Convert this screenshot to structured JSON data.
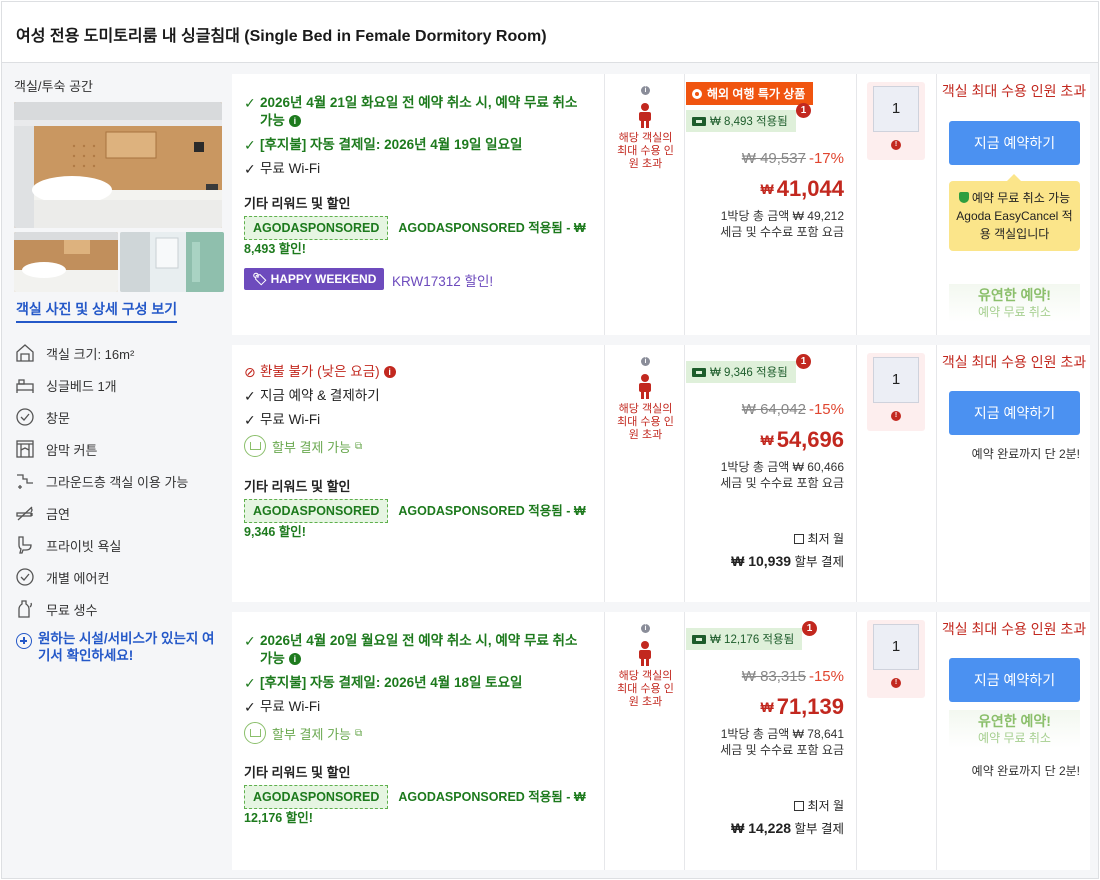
{
  "room": {
    "title": "여성 전용 도미토리룸 내 싱글침대 (Single Bed in Female Dormitory Room)",
    "space_label": "객실/투숙 공간",
    "photos_link": "객실 사진 및 상세 구성 보기",
    "features": [
      {
        "icon": "room-size-icon",
        "label": "객실 크기: 16m²"
      },
      {
        "icon": "single-bed-icon",
        "label": "싱글베드 1개"
      },
      {
        "icon": "window-icon",
        "label": "창문"
      },
      {
        "icon": "blackout-curtain-icon",
        "label": "암막 커튼"
      },
      {
        "icon": "ground-floor-icon",
        "label": "그라운드층 객실 이용 가능"
      },
      {
        "icon": "no-smoking-icon",
        "label": "금연"
      },
      {
        "icon": "private-bathroom-icon",
        "label": "프라이빗 욕실"
      },
      {
        "icon": "air-conditioner-icon",
        "label": "개별 에어컨"
      },
      {
        "icon": "water-bottle-icon",
        "label": "무료 생수"
      }
    ],
    "help_link": "원하는 시설/서비스가 있는지 여기서 확인하세요!"
  },
  "common": {
    "rewards_heading": "기타 리워드 및 할인",
    "agoda_tag": "AGODASPONSORED",
    "occupancy_text": "해당 객실의 최대 수용 인원 초과",
    "qty_value": "1",
    "max_occupancy": "객실 최대 수용 인원 초과",
    "book_button": "지금 예약하기",
    "flex_title": "유연한 예약!",
    "flex_sub": "예약 무료 취소",
    "finish_note": "예약 완료까지 단 2분!",
    "installment_available": "할부 결제 가능",
    "installment_min_label": "최저 월",
    "installment_suffix": "할부 결제",
    "per_night_prefix": "1박당 총 금액",
    "tax_note": "세금 및 수수료 포함 요금",
    "currency": "₩",
    "free_wifi": "무료 Wi-Fi"
  },
  "offers": [
    {
      "lines": [
        {
          "kind": "green",
          "text": "2026년 4월 21일 화요일 전 예약 취소 시, 예약 무료 취소 가능",
          "info": true
        },
        {
          "kind": "green",
          "text": "[후지불] 자동 결제일: 2026년 4월 19일 일요일"
        },
        {
          "kind": "plain",
          "text": "무료 Wi-Fi"
        }
      ],
      "promo_text": "AGODASPONSORED 적용됨 - ₩ 8,493 할인!",
      "happy_tag": "HAPPY WEEKEND",
      "happy_text": "KRW17312 할인!",
      "deal_badge": "해외 여행 특가 상품",
      "coupon": "₩ 8,493 적용됨",
      "coupon_count": "1",
      "original_price": "₩ 49,537",
      "discount_pct": "-17%",
      "price": "41,044",
      "per_night": "₩ 49,212",
      "tooltip_title": "예약 무료 취소 가능",
      "tooltip_body": "Agoda EasyCancel 적용 객실입니다"
    },
    {
      "lines": [
        {
          "kind": "red",
          "text": "환불 불가 (낮은 요금)",
          "info": true
        },
        {
          "kind": "plain",
          "text": "지금 예약 & 결제하기"
        },
        {
          "kind": "plain",
          "text": "무료 Wi-Fi"
        }
      ],
      "promo_text": "AGODASPONSORED 적용됨 - ₩ 9,346 할인!",
      "coupon": "₩ 9,346 적용됨",
      "coupon_count": "1",
      "original_price": "₩ 64,042",
      "discount_pct": "-15%",
      "price": "54,696",
      "per_night": "₩ 60,466",
      "installment_amount": "₩ 10,939"
    },
    {
      "lines": [
        {
          "kind": "green",
          "text": "2026년 4월 20일 월요일 전 예약 취소 시, 예약 무료 취소 가능",
          "info": true
        },
        {
          "kind": "green",
          "text": "[후지불] 자동 결제일: 2026년 4월 18일 토요일"
        },
        {
          "kind": "plain",
          "text": "무료 Wi-Fi"
        }
      ],
      "promo_text": "AGODASPONSORED 적용됨 - ₩ 12,176 할인!",
      "coupon": "₩ 12,176 적용됨",
      "coupon_count": "1",
      "original_price": "₩ 83,315",
      "discount_pct": "-15%",
      "price": "71,139",
      "per_night": "₩ 78,641",
      "installment_amount": "₩ 14,228"
    }
  ],
  "colors": {
    "brand_blue": "#4b91f1",
    "green": "#1d7a1d",
    "red": "#c2281f",
    "deal_orange": "#f0540f",
    "happy_purple": "#6d4bbd"
  }
}
